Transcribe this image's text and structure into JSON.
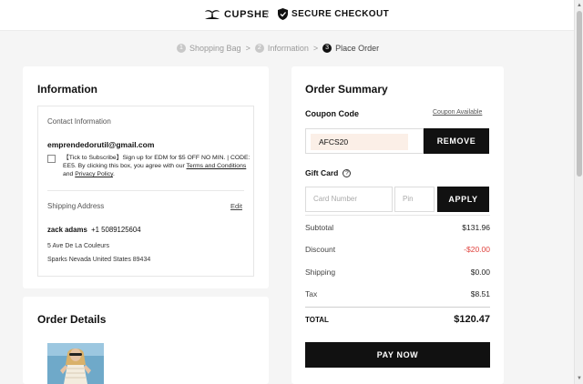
{
  "header": {
    "brand": "CUPSHE",
    "separator": "/",
    "secure_label": "SECURE CHECKOUT"
  },
  "breadcrumb": {
    "steps": [
      {
        "num": "1",
        "label": "Shopping Bag"
      },
      {
        "num": "2",
        "label": "Information"
      },
      {
        "num": "3",
        "label": "Place Order"
      }
    ],
    "separator": ">"
  },
  "information": {
    "title": "Information",
    "contact_label": "Contact Information",
    "email": "emprendedorutil@gmail.com",
    "subscribe_text": "【Tick to Subscribe】Sign up for EDM for $5 OFF NO MIN. | CODE: EE5. By clicking this box, you agree with our ",
    "terms_link": "Terms and Conditions",
    "and_text": " and ",
    "privacy_link": "Privacy Policy",
    "period": ".",
    "shipping_label": "Shipping Address",
    "edit_label": "Edit",
    "name": "zack adams",
    "phone": "+1 5089125604",
    "address_line1": "5 Ave De La Couleurs",
    "address_line2": "Sparks Nevada United States 89434"
  },
  "order_details": {
    "title": "Order Details"
  },
  "summary": {
    "title": "Order Summary",
    "coupon_label": "Coupon Code",
    "coupon_available": "Coupon Available",
    "coupon_value": "AFCS20",
    "remove_label": "REMOVE",
    "gift_card_label": "Gift Card",
    "help_glyph": "?",
    "card_number_placeholder": "Card Number",
    "pin_placeholder": "Pin",
    "apply_label": "APPLY",
    "subtotal_label": "Subtotal",
    "subtotal_value": "$131.96",
    "discount_label": "Discount",
    "discount_value": "-$20.00",
    "shipping_label": "Shipping",
    "shipping_value": "$0.00",
    "tax_label": "Tax",
    "tax_value": "$8.51",
    "total_label": "TOTAL",
    "total_value": "$120.47",
    "pay_label": "PAY NOW"
  },
  "colors": {
    "accent_black": "#111111",
    "discount_red": "#e0433e",
    "coupon_highlight": "#fbefe7",
    "page_background": "#f5f5f5"
  },
  "icons": {
    "logo": "palm-island-logo",
    "secure": "shield-check-icon",
    "help": "question-circle-icon"
  }
}
